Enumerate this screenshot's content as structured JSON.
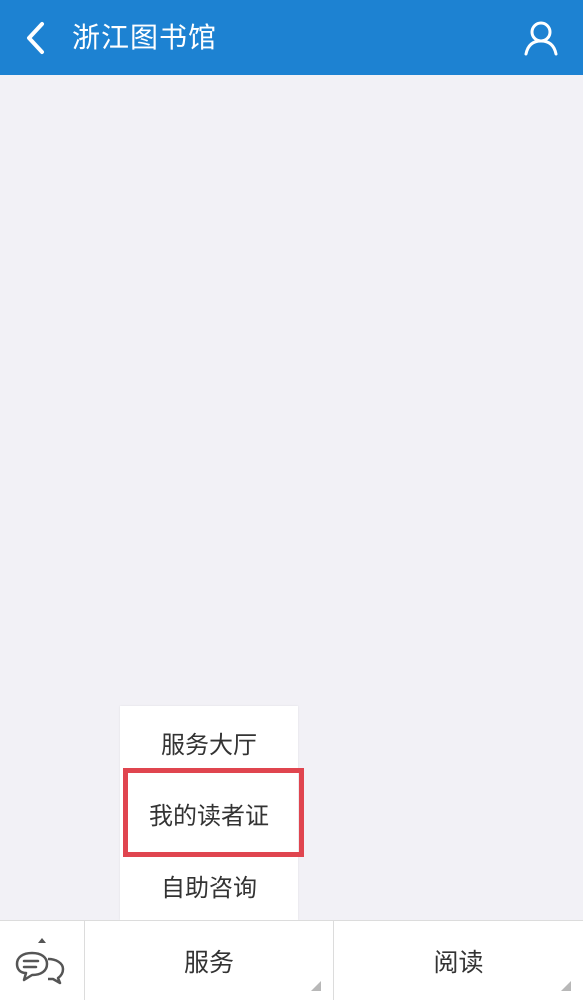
{
  "header": {
    "title": "浙江图书馆",
    "background": "#1d82d2",
    "back_icon": "chevron-left-icon",
    "profile_icon": "user-icon"
  },
  "popup_menu": {
    "items": [
      {
        "label": "服务大厅"
      },
      {
        "label": "我的读者证",
        "highlighted": true
      },
      {
        "label": "自助咨询"
      }
    ],
    "highlight_color": "#e0454f"
  },
  "bottom_bar": {
    "keyboard_toggle_icon": "chat-bubbles-icon",
    "tabs": [
      {
        "label": "服务"
      },
      {
        "label": "阅读"
      }
    ]
  }
}
